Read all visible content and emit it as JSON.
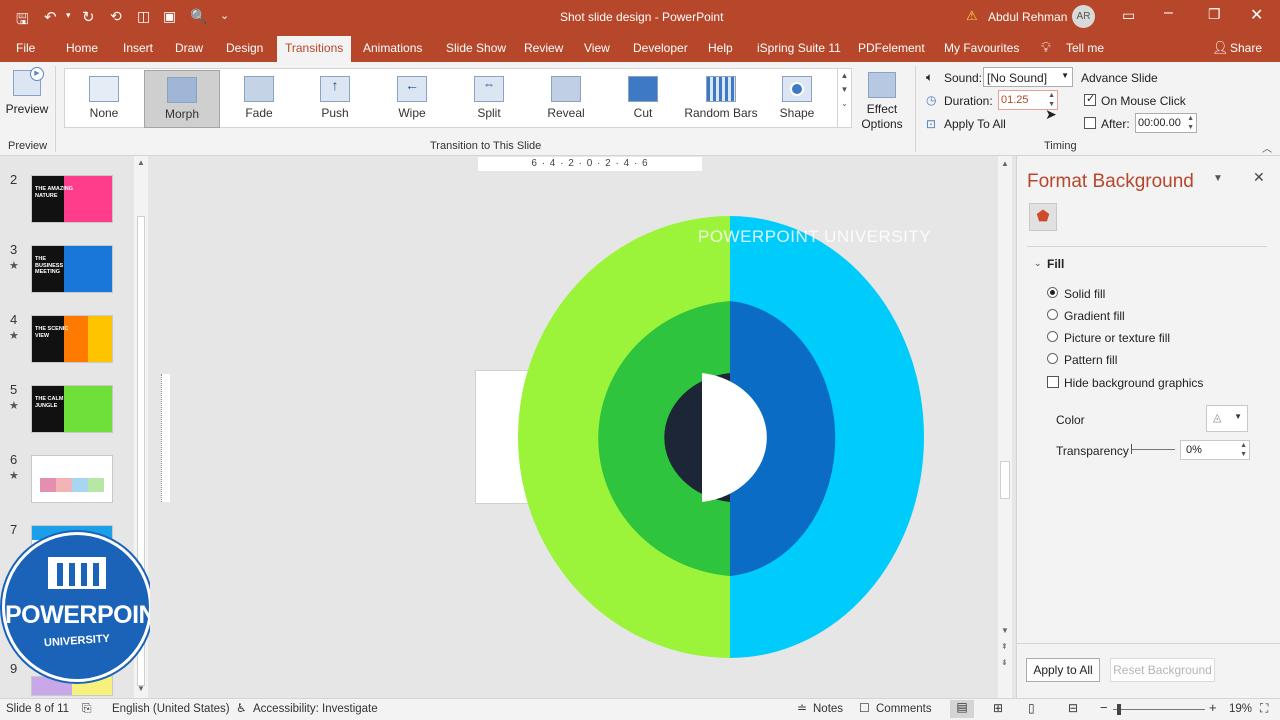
{
  "title_bar": {
    "title": "Shot slide design  -  PowerPoint",
    "user_name": "Abdul Rehman",
    "avatar_initials": "AR"
  },
  "tabs": [
    "File",
    "Home",
    "Insert",
    "Draw",
    "Design",
    "Transitions",
    "Animations",
    "Slide Show",
    "Review",
    "View",
    "Developer",
    "Help",
    "iSpring Suite 11",
    "PDFelement",
    "My Favourites",
    "Tell me"
  ],
  "share_label": "Share",
  "ribbon": {
    "preview_label": "Preview",
    "preview_group": "Preview",
    "transitions": [
      "None",
      "Morph",
      "Fade",
      "Push",
      "Wipe",
      "Split",
      "Reveal",
      "Cut",
      "Random Bars",
      "Shape"
    ],
    "transition_group": "Transition to This Slide",
    "effect_options": "Effect Options",
    "sound_label": "Sound:",
    "sound_value": "[No Sound]",
    "duration_label": "Duration:",
    "duration_value": "01.25",
    "apply_all": "Apply To All",
    "advance_slide": "Advance Slide",
    "on_mouse_click": "On Mouse Click",
    "after_label": "After:",
    "after_value": "00:00.00",
    "timing_group": "Timing"
  },
  "thumbnails": [
    {
      "num": "2",
      "star": "",
      "text": "THE AMAZING NATURE"
    },
    {
      "num": "3",
      "star": "★",
      "text": "THE BUSINESS MEETING"
    },
    {
      "num": "4",
      "star": "★",
      "text": "THE SCENIC VIEW"
    },
    {
      "num": "5",
      "star": "★",
      "text": "THE CALM JUNGLE"
    },
    {
      "num": "6",
      "star": "★",
      "text": ""
    },
    {
      "num": "7",
      "star": "",
      "text": ""
    },
    {
      "num": "9",
      "star": "",
      "text": ""
    }
  ],
  "logo": {
    "text": "POWERPOINT",
    "sub": "UNIVERSITY"
  },
  "ruler_marks": "6 · 4 · 2 · 0 · 2 · 4 · 6",
  "slide": {
    "watermark": "POWERPOINT UNIVERSITY"
  },
  "format_pane": {
    "title": "Format Background",
    "fill_section": "Fill",
    "options": [
      "Solid fill",
      "Gradient fill",
      "Picture or texture fill",
      "Pattern fill"
    ],
    "hide_bg": "Hide background graphics",
    "color_label": "Color",
    "transparency_label": "Transparency",
    "transparency_value": "0%",
    "apply_all": "Apply to All",
    "reset": "Reset Background"
  },
  "status": {
    "slide": "Slide 8 of 11",
    "language": "English (United States)",
    "accessibility": "Accessibility: Investigate",
    "notes": "Notes",
    "comments": "Comments",
    "zoom": "19%"
  },
  "colors": {
    "accent": "#b7472a",
    "lime": "#9cf43a",
    "green": "#2ec43e",
    "cyan": "#00ccfc",
    "blue": "#0a6cc4",
    "navy": "#1c2636"
  }
}
